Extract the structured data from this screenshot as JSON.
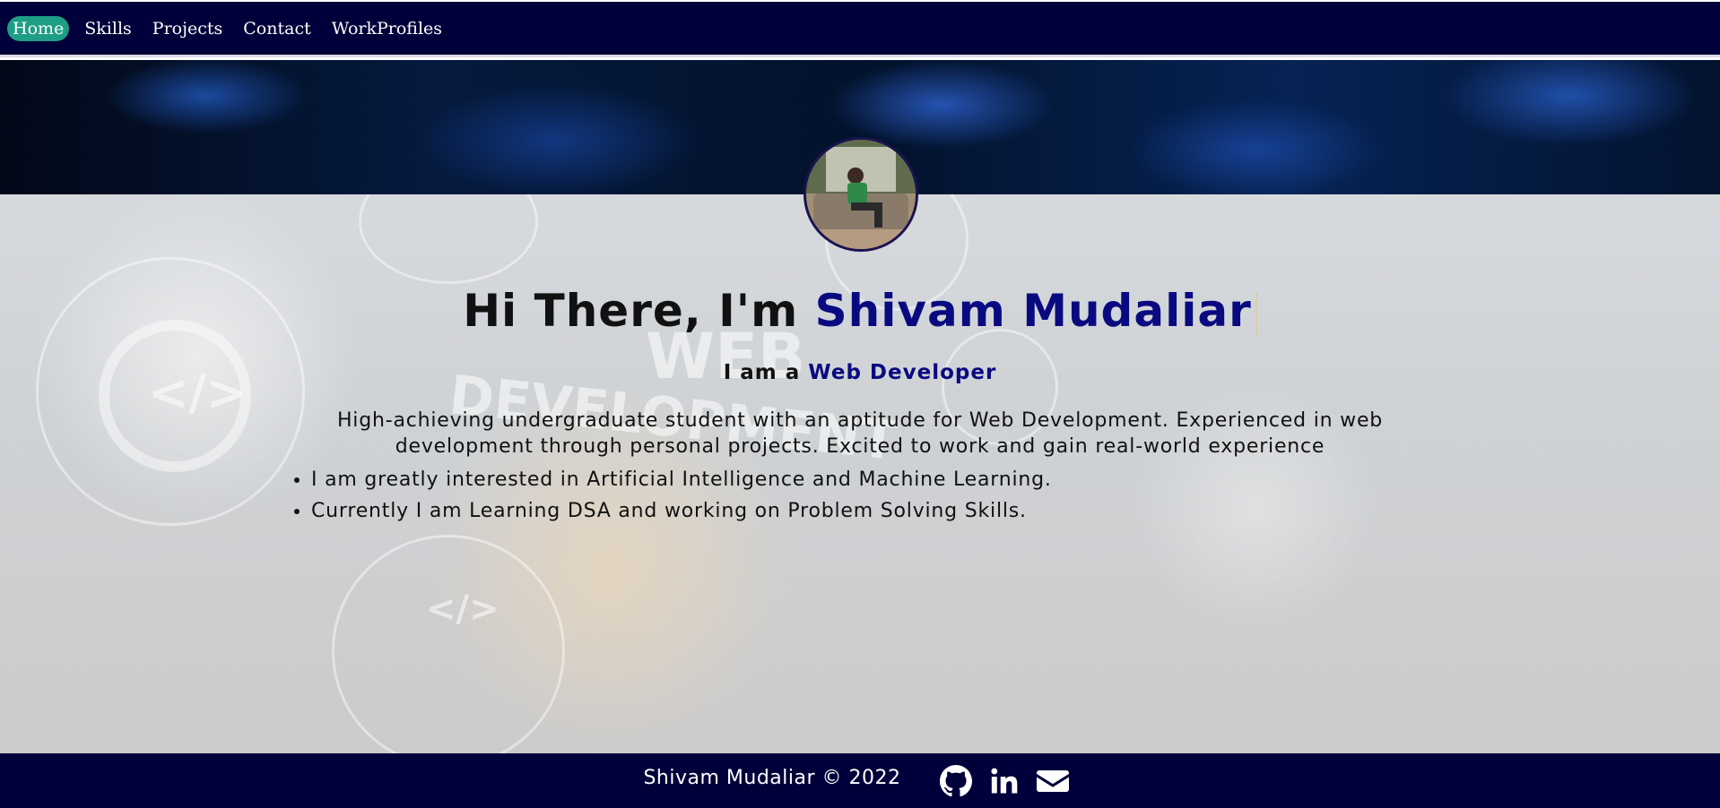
{
  "nav": {
    "items": [
      {
        "label": "Home",
        "active": true
      },
      {
        "label": "Skills",
        "active": false
      },
      {
        "label": "Projects",
        "active": false
      },
      {
        "label": "Contact",
        "active": false
      },
      {
        "label": "WorkProfiles",
        "active": false
      }
    ],
    "active_color": "#1f9e86",
    "background": "#00003a"
  },
  "hero": {
    "greeting": "Hi There, I'm",
    "name": "Shivam Mudaliar",
    "role_prefix": "I am a",
    "role": "Web Developer",
    "about": "High-achieving undergraduate student with an aptitude for Web Development. Experienced in web development through personal projects. Excited to work and gain real-world experience",
    "bullets": [
      "I am greatly interested in Artificial Intelligence and Machine Learning.",
      "Currently I am Learning DSA and working on Problem Solving Skills."
    ],
    "accent_color": "#0a0a80",
    "background_text": [
      "WEB",
      "DEVELOPMENT"
    ]
  },
  "footer": {
    "copyright": "Shivam Mudaliar © 2022",
    "icons": [
      "github-icon",
      "linkedin-icon",
      "envelope-icon"
    ]
  }
}
